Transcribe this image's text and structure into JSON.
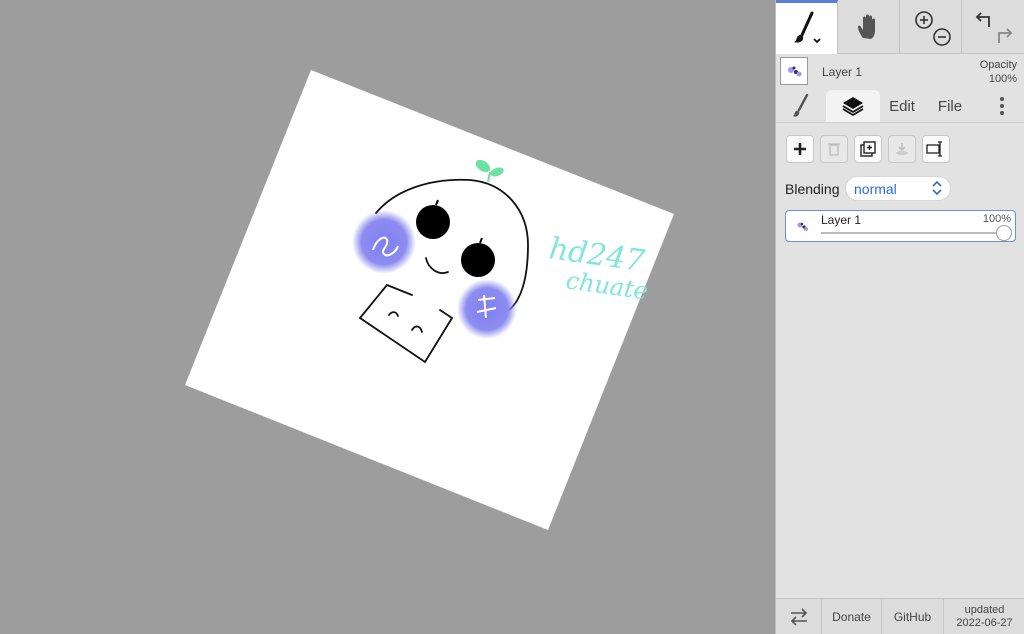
{
  "canvas": {
    "handwriting_line1": "hd247",
    "handwriting_line2": "chuate"
  },
  "panel": {
    "toolbar": {
      "tools": [
        "brush-icon",
        "hand-icon",
        "zoom-in-icon",
        "zoom-out-icon",
        "undo-icon",
        "redo-icon"
      ]
    },
    "layer_header": {
      "name": "Layer 1",
      "opacity_label": "Opacity",
      "opacity_value": "100%"
    },
    "tabs": {
      "edit": "Edit",
      "file": "File"
    },
    "layers_tab": {
      "blending_label": "Blending",
      "blending_value": "normal",
      "layer_item": {
        "name": "Layer 1",
        "opacity": "100%",
        "opacity_fraction": 1.0
      }
    },
    "footer": {
      "donate": "Donate",
      "github": "GitHub",
      "updated_label": "updated",
      "updated_date": "2022-06-27"
    }
  },
  "colors": {
    "background": "#9d9d9d",
    "panel": "#e2e2e2",
    "accent": "#2b6fd1",
    "blush": "#8c8cf0",
    "sprout": "#6ee0a0",
    "handwriting": "#7fe6dd"
  }
}
